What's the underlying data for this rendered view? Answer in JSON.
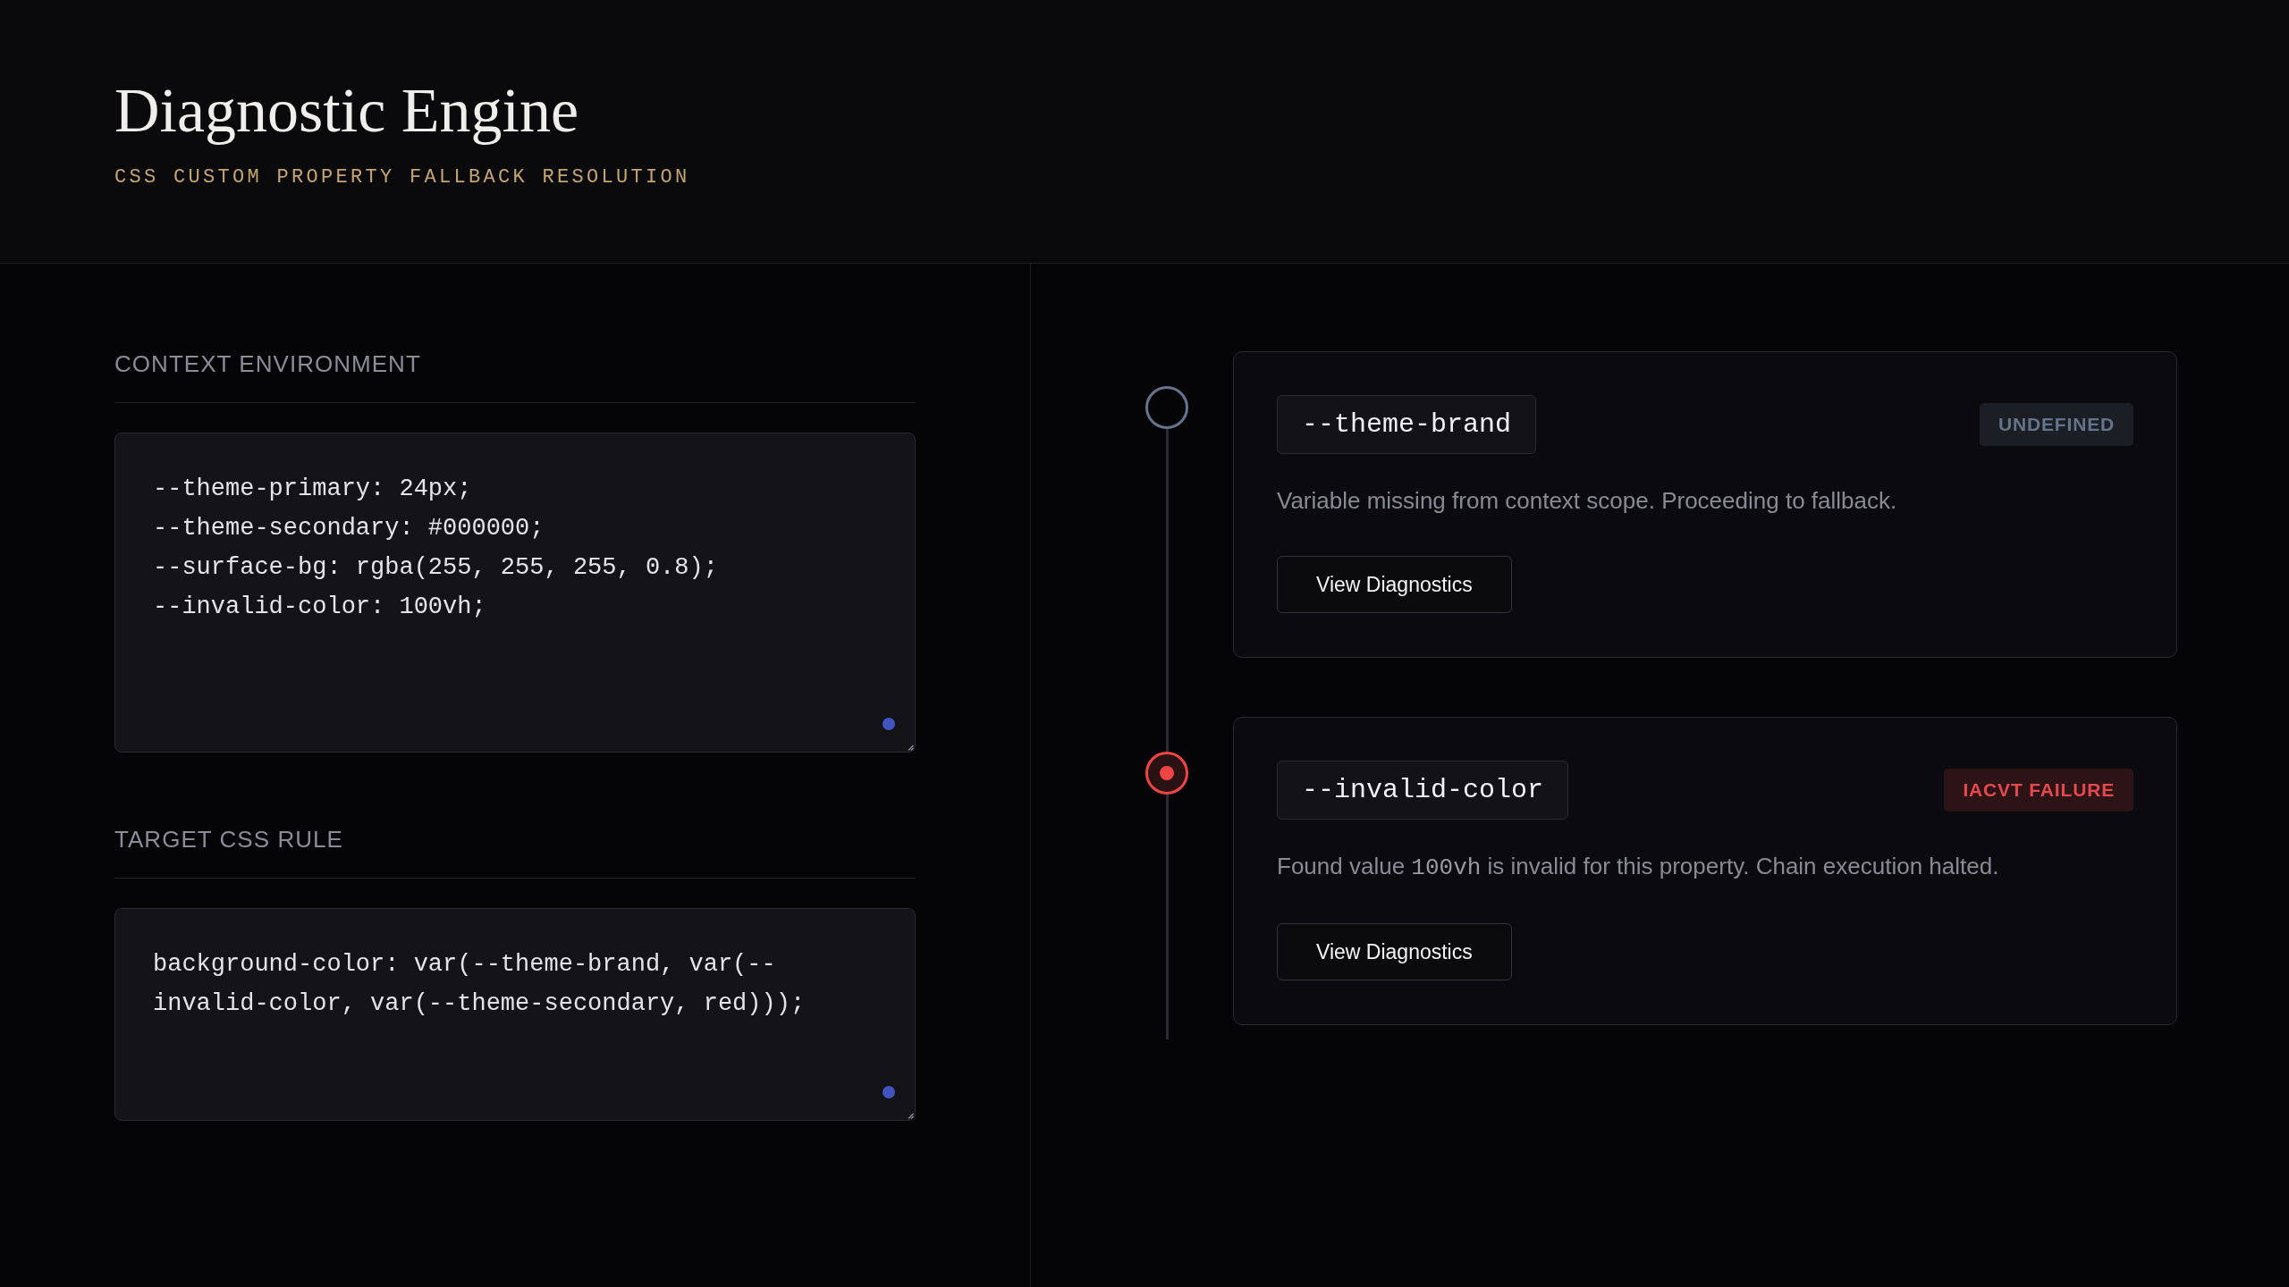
{
  "header": {
    "title": "Diagnostic Engine",
    "subtitle": "CSS CUSTOM PROPERTY FALLBACK RESOLUTION"
  },
  "sections": [
    {
      "heading": "CONTEXT ENVIRONMENT",
      "editor": {
        "value": "--theme-primary: 24px;\n--theme-secondary: #000000;\n--surface-bg: rgba(255, 255, 255, 0.8);\n--invalid-color: 100vh;"
      }
    },
    {
      "heading": "TARGET CSS RULE",
      "editor": {
        "value": "background-color: var(--theme-brand, var(--invalid-color, var(--theme-secondary, red)));"
      }
    }
  ],
  "resolution_steps": [
    {
      "kind": "undefined",
      "variable": "--theme-brand",
      "badge": "UNDEFINED",
      "description": [
        {
          "kind": "text",
          "text": "Variable missing from context scope. Proceeding to fallback."
        }
      ],
      "button": "View Diagnostics"
    },
    {
      "kind": "failure",
      "variable": "--invalid-color",
      "badge": "IACVT FAILURE",
      "description": [
        {
          "kind": "text",
          "text": "Found value "
        },
        {
          "kind": "code",
          "text": "100vh"
        },
        {
          "kind": "text",
          "text": " is invalid for this property. Chain execution halted."
        }
      ],
      "button": "View Diagnostics"
    }
  ]
}
